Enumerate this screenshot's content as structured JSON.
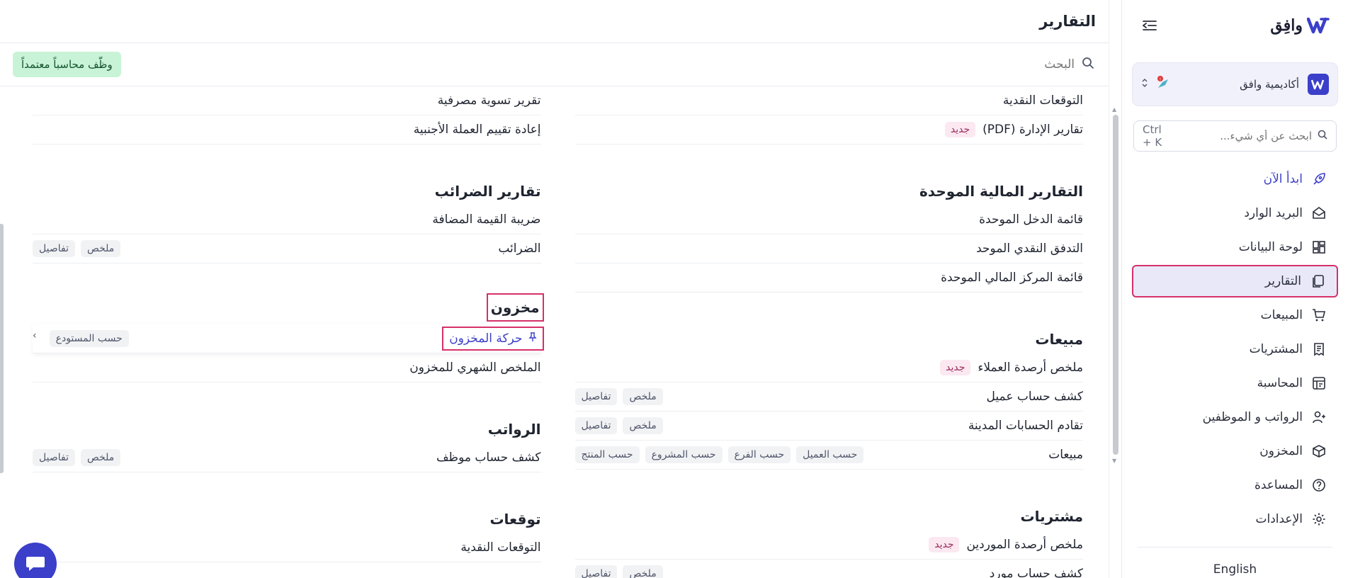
{
  "brand": {
    "name": "وافِق"
  },
  "org": {
    "name": "أكاديمية وافق"
  },
  "global_search": {
    "placeholder": "ابحث عن أي شيء...",
    "shortcut": "Ctrl + K"
  },
  "nav": [
    {
      "label": "ابدأ الآن",
      "icon": "rocket-icon"
    },
    {
      "label": "البريد الوارد",
      "icon": "inbox-icon"
    },
    {
      "label": "لوحة البيانات",
      "icon": "dashboard-icon"
    },
    {
      "label": "التقارير",
      "icon": "reports-icon"
    },
    {
      "label": "المبيعات",
      "icon": "cart-icon"
    },
    {
      "label": "المشتريات",
      "icon": "receipt-icon"
    },
    {
      "label": "المحاسبة",
      "icon": "ledger-icon"
    },
    {
      "label": "الرواتب و الموظفين",
      "icon": "users-icon"
    },
    {
      "label": "المخزون",
      "icon": "box-icon"
    },
    {
      "label": "المساعدة",
      "icon": "help-icon"
    },
    {
      "label": "الإعدادات",
      "icon": "gear-icon"
    }
  ],
  "language_toggle": "English",
  "page": {
    "title": "التقارير"
  },
  "report_search": {
    "placeholder": "البحث"
  },
  "hire_button": "وظّف محاسباً معتمداً",
  "badges": {
    "new": "جديد",
    "summary": "ملخص",
    "details": "تفاصيل",
    "by_warehouse": "حسب المستودع"
  },
  "right_col": {
    "top_rows": [
      "التوقعات النقدية",
      "تقارير الإدارة (PDF)"
    ],
    "consolidated": {
      "title": "التقارير المالية الموحدة",
      "rows": [
        "قائمة الدخل الموحدة",
        "التدفق النقدي الموحد",
        "قائمة المركز المالي الموحدة"
      ]
    },
    "sales": {
      "title": "مبيعات",
      "rows": [
        "ملخص أرصدة العملاء",
        "كشف حساب عميل",
        "تقادم الحسابات المدينة",
        "مبيعات"
      ],
      "sales_tags": [
        "حسب العميل",
        "حسب الفرع",
        "حسب المشروع",
        "حسب المنتج"
      ]
    },
    "purchases": {
      "title": "مشتريات",
      "rows": [
        "ملخص أرصدة الموردين",
        "كشف حساب مورد"
      ]
    }
  },
  "left_col": {
    "top_rows": [
      "تقرير تسوية مصرفية",
      "إعادة تقييم العملة الأجنبية"
    ],
    "taxes": {
      "title": "تقارير الضرائب",
      "rows": [
        "ضريبة القيمة المضافة",
        "الضرائب"
      ]
    },
    "inventory": {
      "title": "مخزون",
      "rows": [
        "حركة المخزون",
        "الملخص الشهري للمخزون"
      ]
    },
    "payroll": {
      "title": "الرواتب",
      "rows": [
        "كشف حساب موظف"
      ]
    },
    "forecasts": {
      "title": "توقعات",
      "rows": [
        "التوقعات النقدية"
      ]
    }
  }
}
